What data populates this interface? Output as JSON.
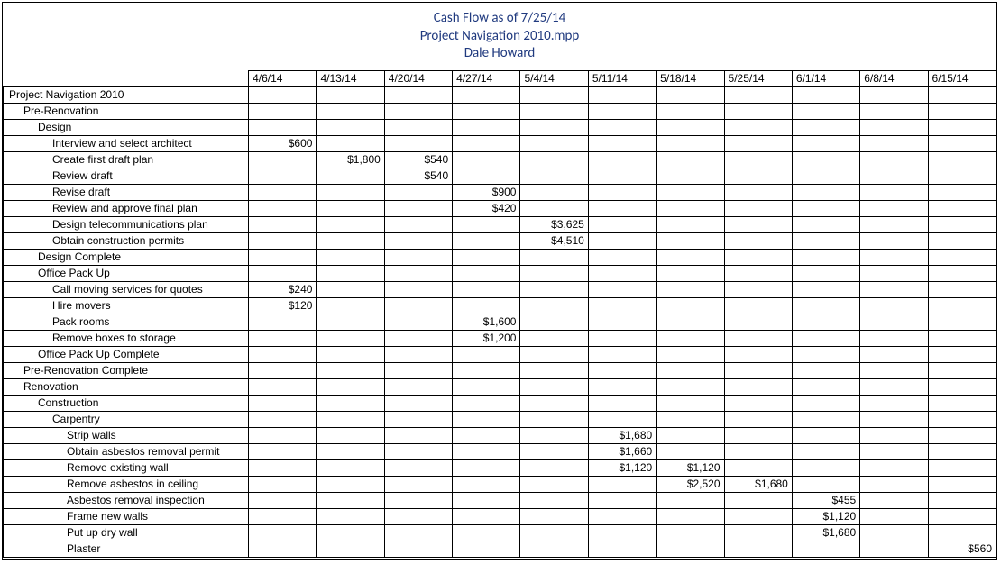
{
  "header": {
    "title": "Cash Flow as of 7/25/14",
    "subtitle": "Project Navigation 2010.mpp",
    "author": "Dale Howard"
  },
  "dates": [
    "4/6/14",
    "4/13/14",
    "4/20/14",
    "4/27/14",
    "5/4/14",
    "5/11/14",
    "5/18/14",
    "5/25/14",
    "6/1/14",
    "6/8/14",
    "6/15/14"
  ],
  "rows": [
    {
      "indent": 0,
      "name": "Project Navigation 2010",
      "vals": [
        "",
        "",
        "",
        "",
        "",
        "",
        "",
        "",
        "",
        "",
        ""
      ]
    },
    {
      "indent": 1,
      "name": "Pre-Renovation",
      "vals": [
        "",
        "",
        "",
        "",
        "",
        "",
        "",
        "",
        "",
        "",
        ""
      ]
    },
    {
      "indent": 2,
      "name": "Design",
      "vals": [
        "",
        "",
        "",
        "",
        "",
        "",
        "",
        "",
        "",
        "",
        ""
      ]
    },
    {
      "indent": 3,
      "name": "Interview and select architect",
      "vals": [
        "$600",
        "",
        "",
        "",
        "",
        "",
        "",
        "",
        "",
        "",
        ""
      ]
    },
    {
      "indent": 3,
      "name": "Create first draft plan",
      "vals": [
        "",
        "$1,800",
        "$540",
        "",
        "",
        "",
        "",
        "",
        "",
        "",
        ""
      ]
    },
    {
      "indent": 3,
      "name": "Review draft",
      "vals": [
        "",
        "",
        "$540",
        "",
        "",
        "",
        "",
        "",
        "",
        "",
        ""
      ]
    },
    {
      "indent": 3,
      "name": "Revise draft",
      "vals": [
        "",
        "",
        "",
        "$900",
        "",
        "",
        "",
        "",
        "",
        "",
        ""
      ]
    },
    {
      "indent": 3,
      "name": "Review and approve final plan",
      "vals": [
        "",
        "",
        "",
        "$420",
        "",
        "",
        "",
        "",
        "",
        "",
        ""
      ]
    },
    {
      "indent": 3,
      "name": "Design telecommunications plan",
      "vals": [
        "",
        "",
        "",
        "",
        "$3,625",
        "",
        "",
        "",
        "",
        "",
        ""
      ]
    },
    {
      "indent": 3,
      "name": "Obtain construction permits",
      "vals": [
        "",
        "",
        "",
        "",
        "$4,510",
        "",
        "",
        "",
        "",
        "",
        ""
      ]
    },
    {
      "indent": 2,
      "name": "Design Complete",
      "vals": [
        "",
        "",
        "",
        "",
        "",
        "",
        "",
        "",
        "",
        "",
        ""
      ]
    },
    {
      "indent": 2,
      "name": "Office Pack Up",
      "vals": [
        "",
        "",
        "",
        "",
        "",
        "",
        "",
        "",
        "",
        "",
        ""
      ]
    },
    {
      "indent": 3,
      "name": "Call moving services for quotes",
      "vals": [
        "$240",
        "",
        "",
        "",
        "",
        "",
        "",
        "",
        "",
        "",
        ""
      ]
    },
    {
      "indent": 3,
      "name": "Hire movers",
      "vals": [
        "$120",
        "",
        "",
        "",
        "",
        "",
        "",
        "",
        "",
        "",
        ""
      ]
    },
    {
      "indent": 3,
      "name": "Pack rooms",
      "vals": [
        "",
        "",
        "",
        "$1,600",
        "",
        "",
        "",
        "",
        "",
        "",
        ""
      ]
    },
    {
      "indent": 3,
      "name": "Remove boxes to storage",
      "vals": [
        "",
        "",
        "",
        "$1,200",
        "",
        "",
        "",
        "",
        "",
        "",
        ""
      ]
    },
    {
      "indent": 2,
      "name": "Office Pack Up Complete",
      "vals": [
        "",
        "",
        "",
        "",
        "",
        "",
        "",
        "",
        "",
        "",
        ""
      ]
    },
    {
      "indent": 1,
      "name": "Pre-Renovation Complete",
      "vals": [
        "",
        "",
        "",
        "",
        "",
        "",
        "",
        "",
        "",
        "",
        ""
      ]
    },
    {
      "indent": 1,
      "name": "Renovation",
      "vals": [
        "",
        "",
        "",
        "",
        "",
        "",
        "",
        "",
        "",
        "",
        ""
      ]
    },
    {
      "indent": 2,
      "name": "Construction",
      "vals": [
        "",
        "",
        "",
        "",
        "",
        "",
        "",
        "",
        "",
        "",
        ""
      ]
    },
    {
      "indent": 3,
      "name": "Carpentry",
      "vals": [
        "",
        "",
        "",
        "",
        "",
        "",
        "",
        "",
        "",
        "",
        ""
      ]
    },
    {
      "indent": 4,
      "name": "Strip walls",
      "vals": [
        "",
        "",
        "",
        "",
        "",
        "$1,680",
        "",
        "",
        "",
        "",
        ""
      ]
    },
    {
      "indent": 4,
      "name": "Obtain asbestos removal permit",
      "vals": [
        "",
        "",
        "",
        "",
        "",
        "$1,660",
        "",
        "",
        "",
        "",
        ""
      ]
    },
    {
      "indent": 4,
      "name": "Remove existing wall",
      "vals": [
        "",
        "",
        "",
        "",
        "",
        "$1,120",
        "$1,120",
        "",
        "",
        "",
        ""
      ]
    },
    {
      "indent": 4,
      "name": "Remove asbestos in ceiling",
      "vals": [
        "",
        "",
        "",
        "",
        "",
        "",
        "$2,520",
        "$1,680",
        "",
        "",
        ""
      ]
    },
    {
      "indent": 4,
      "name": "Asbestos removal inspection",
      "vals": [
        "",
        "",
        "",
        "",
        "",
        "",
        "",
        "",
        "$455",
        "",
        ""
      ]
    },
    {
      "indent": 4,
      "name": "Frame new walls",
      "vals": [
        "",
        "",
        "",
        "",
        "",
        "",
        "",
        "",
        "$1,120",
        "",
        ""
      ]
    },
    {
      "indent": 4,
      "name": "Put up dry wall",
      "vals": [
        "",
        "",
        "",
        "",
        "",
        "",
        "",
        "",
        "$1,680",
        "",
        ""
      ]
    },
    {
      "indent": 4,
      "name": "Plaster",
      "vals": [
        "",
        "",
        "",
        "",
        "",
        "",
        "",
        "",
        "",
        "",
        "$560"
      ]
    }
  ]
}
